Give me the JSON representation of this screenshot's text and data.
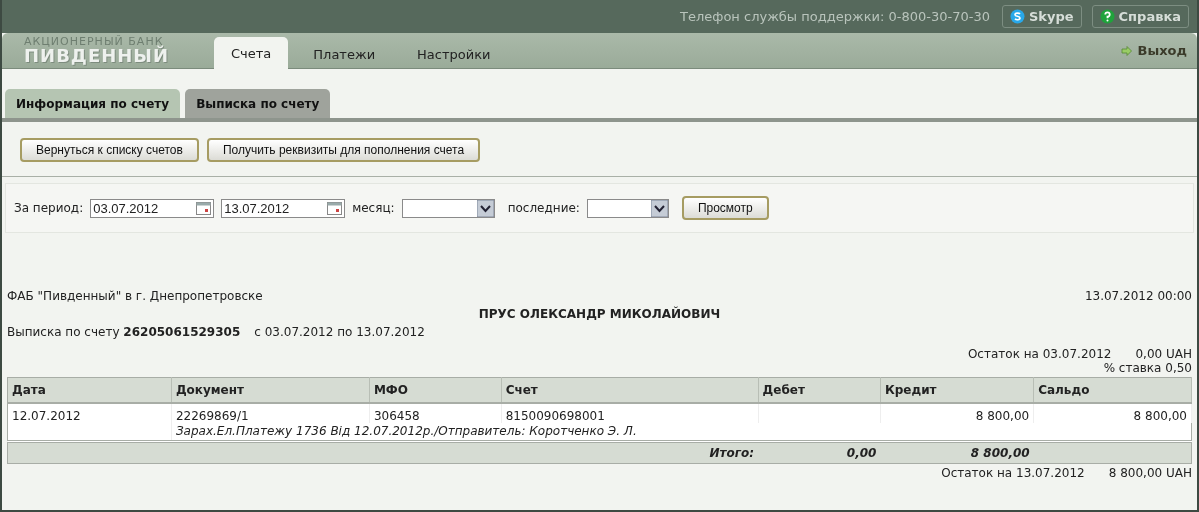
{
  "top_bar": {
    "support_phone": "Телефон службы поддержки: 0-800-30-70-30",
    "buttons": [
      {
        "label": "Skype",
        "kind": "skype"
      },
      {
        "label": "Справка",
        "kind": "help"
      }
    ]
  },
  "logo": {
    "line1": "АКЦИОНЕРНЫЙ БАНК",
    "line2": "ПИВДЕННЫЙ"
  },
  "nav_tabs": [
    {
      "label": "Счета",
      "selected": true
    },
    {
      "label": "Платежи",
      "selected": false
    },
    {
      "label": "Настройки",
      "selected": false
    }
  ],
  "logout": "Выход",
  "sub_tabs": [
    {
      "label": "Информация по счету",
      "selected": false
    },
    {
      "label": "Выписка по счету",
      "selected": true
    }
  ],
  "actions": [
    "Вернуться к списку счетов",
    "Получить реквизиты для пополнения счета"
  ],
  "filter": {
    "period_label": "За период:",
    "date_from": "03.07.2012",
    "date_to": "13.07.2012",
    "month_label": "месяц:",
    "last_label": "последние:",
    "view_button": "Просмотр"
  },
  "report": {
    "bank": "ФАБ \"Пивденный\" в г. Днепропетровске",
    "datetime": "13.07.2012 00:00",
    "holder": "ПРУС ОЛЕКСАНДР МИКОЛАЙОВИЧ",
    "statement": "Выписка по счету **26205061529305**",
    "period": "с 03.07.2012 по 13.07.2012",
    "opening_label": "Остаток на 03.07.2012",
    "opening_value": "0,00 UAH",
    "rate": "% ставка 0,50",
    "table": {
      "columns": [
        "Дата",
        "Документ",
        "МФО",
        "Счет",
        "Дебет",
        "Кредит",
        "Сальдо"
      ],
      "rows": [
        {
          "cells": [
            "12.07.2012",
            "22269869/1",
            "306458",
            "8150090698001",
            "",
            "8 800,00",
            "8 800,00"
          ],
          "note": "Зарах.Ел.Платежу 1736 Від 12.07.2012р./Отправитель: Коротченко Э. Л."
        }
      ],
      "totals": {
        "label": "Итого:",
        "debit": "0,00",
        "credit": "8 800,00"
      }
    },
    "closing_label": "Остаток на 13.07.2012",
    "closing_value": "8 800,00 UAH"
  }
}
